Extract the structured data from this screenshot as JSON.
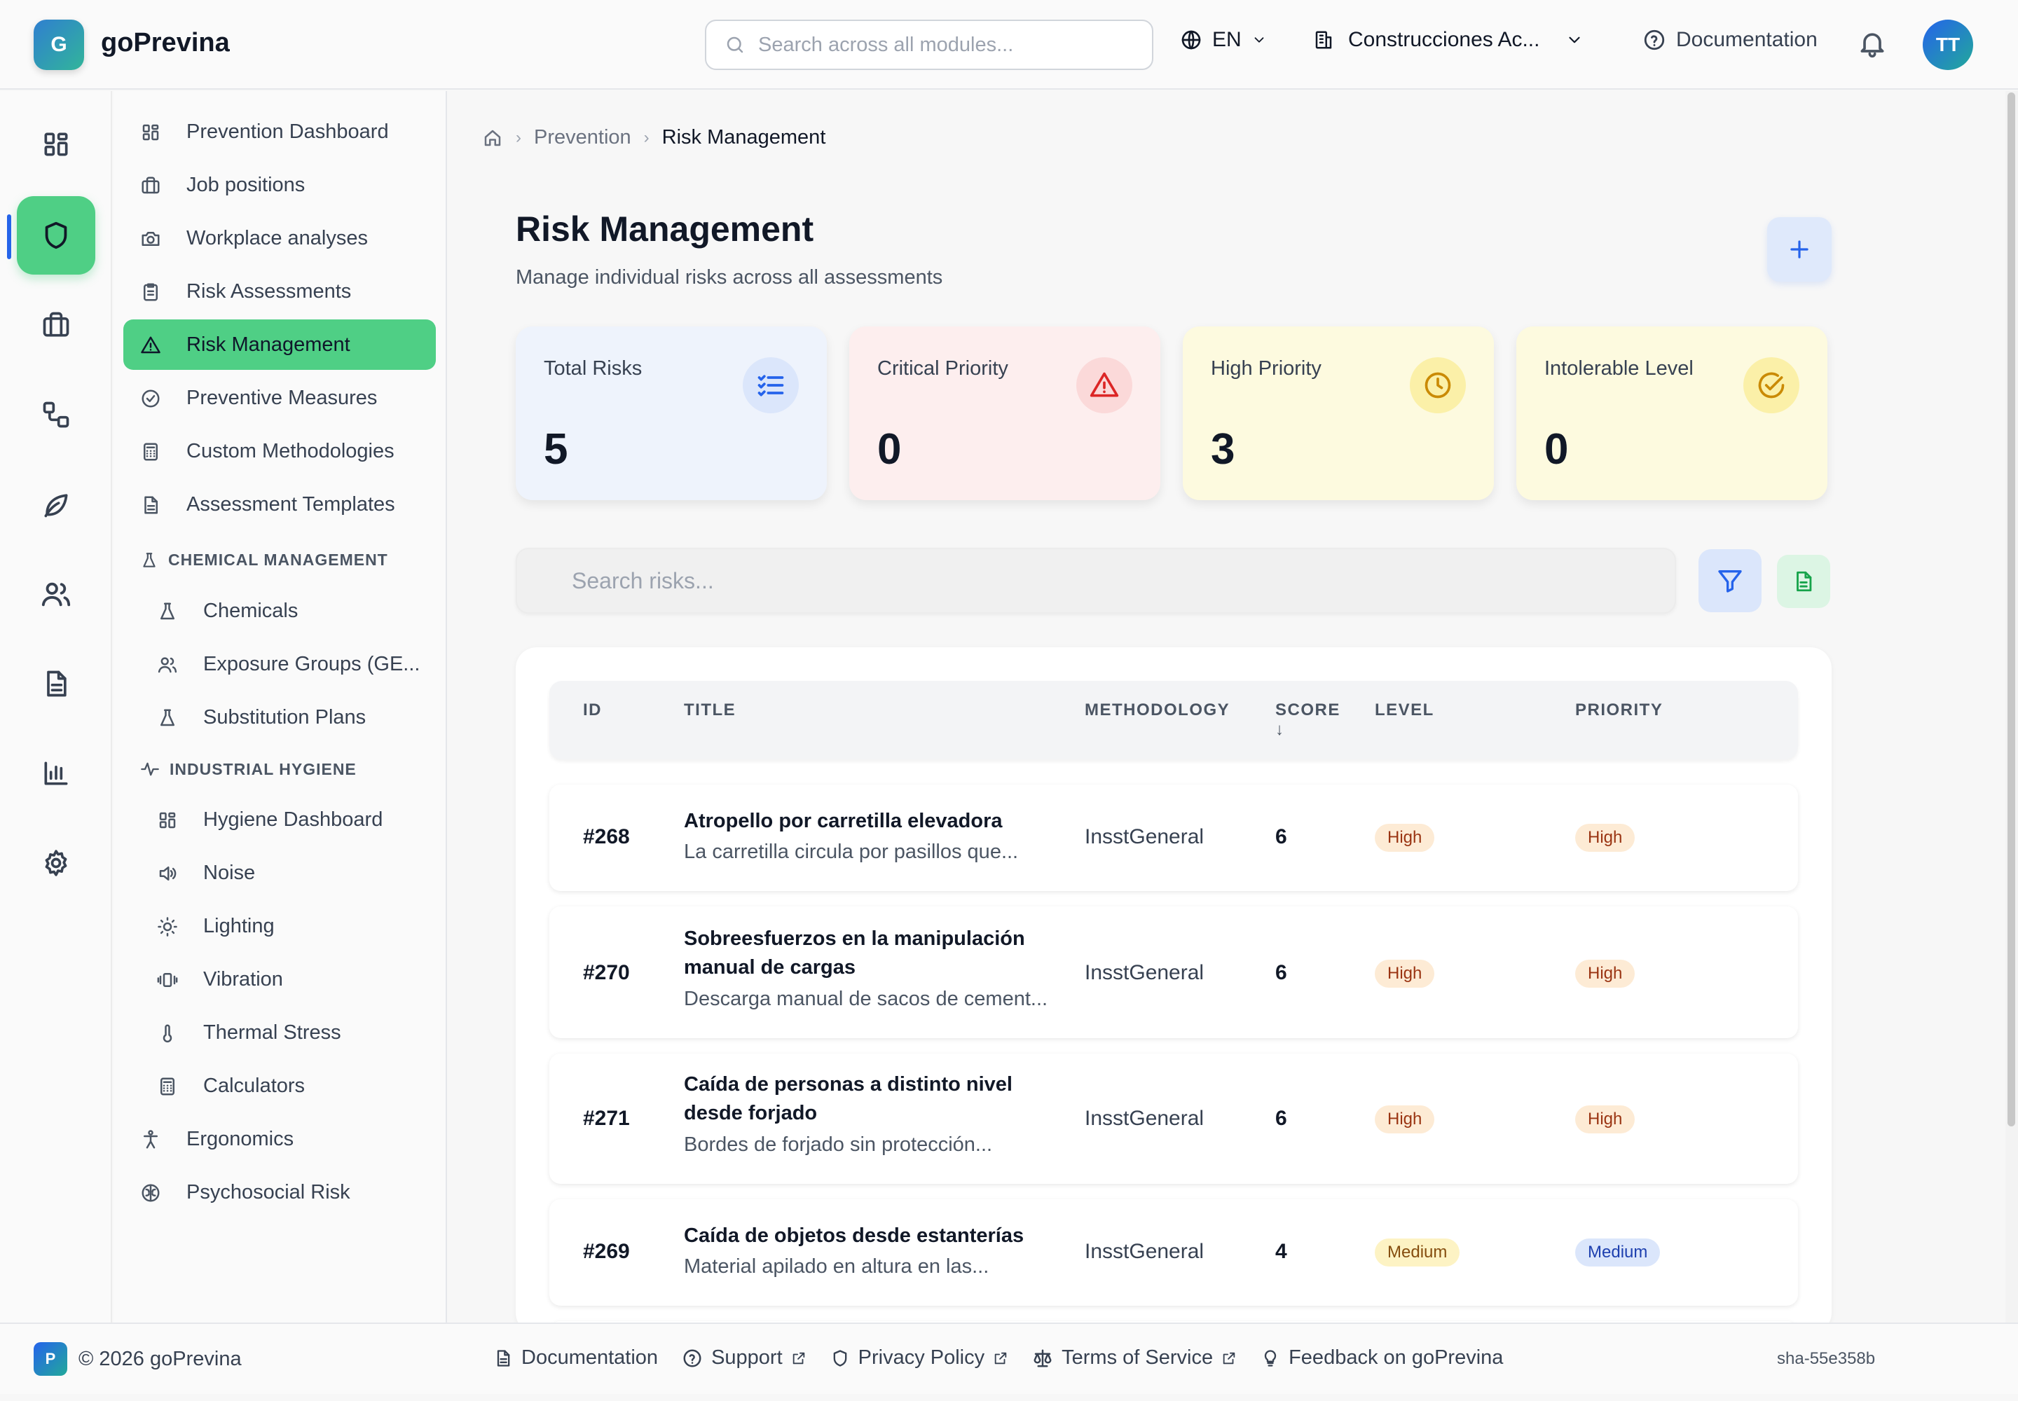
{
  "app": {
    "logo_letter": "G",
    "name": "goPrevina"
  },
  "header": {
    "search_placeholder": "Search across all modules...",
    "language": "EN",
    "organization": "Construcciones Ac...",
    "documentation": "Documentation",
    "user_initials": "TT"
  },
  "rail": {
    "active": "prevention",
    "items": [
      "dashboard",
      "prevention",
      "briefcase",
      "workflow",
      "environment",
      "people",
      "documents",
      "reports",
      "settings"
    ]
  },
  "sidebar": {
    "items": [
      {
        "label": "Prevention Dashboard",
        "icon": "dashboard-icon"
      },
      {
        "label": "Job positions",
        "icon": "briefcase-icon"
      },
      {
        "label": "Workplace analyses",
        "icon": "camera-icon"
      },
      {
        "label": "Risk Assessments",
        "icon": "clipboard-icon"
      },
      {
        "label": "Risk Management",
        "icon": "warning-icon",
        "active": true
      },
      {
        "label": "Preventive Measures",
        "icon": "check-circle-icon"
      },
      {
        "label": "Custom Methodologies",
        "icon": "calculator-icon"
      },
      {
        "label": "Assessment Templates",
        "icon": "document-icon"
      }
    ],
    "chemical_section": "CHEMICAL MANAGEMENT",
    "chemical_items": [
      {
        "label": "Chemicals",
        "icon": "flask-icon"
      },
      {
        "label": "Exposure Groups (GE...",
        "icon": "people-icon"
      },
      {
        "label": "Substitution Plans",
        "icon": "flask-icon"
      }
    ],
    "hygiene_section": "INDUSTRIAL HYGIENE",
    "hygiene_items": [
      {
        "label": "Hygiene Dashboard",
        "icon": "dashboard-icon"
      },
      {
        "label": "Noise",
        "icon": "speaker-icon"
      },
      {
        "label": "Lighting",
        "icon": "sun-icon"
      },
      {
        "label": "Vibration",
        "icon": "vibration-icon"
      },
      {
        "label": "Thermal Stress",
        "icon": "thermometer-icon"
      },
      {
        "label": "Calculators",
        "icon": "calculator-icon"
      }
    ],
    "bottom_items": [
      {
        "label": "Ergonomics",
        "icon": "person-icon"
      },
      {
        "label": "Psychosocial Risk",
        "icon": "brain-icon"
      }
    ]
  },
  "breadcrumb": {
    "section": "Prevention",
    "current": "Risk Management"
  },
  "page": {
    "title": "Risk Management",
    "subtitle": "Manage individual risks across all assessments"
  },
  "stats": [
    {
      "label": "Total Risks",
      "value": "5",
      "color": "#eef3fc",
      "accent": "#2563eb"
    },
    {
      "label": "Critical Priority",
      "value": "0",
      "color": "#fdeeee",
      "accent": "#dc2626"
    },
    {
      "label": "High Priority",
      "value": "3",
      "color": "#fdfadf",
      "accent": "#ca8a04"
    },
    {
      "label": "Intolerable Level",
      "value": "0",
      "color": "#fdfadf",
      "accent": "#ca8a04"
    }
  ],
  "risk_search_placeholder": "Search risks...",
  "table": {
    "columns": {
      "id": "ID",
      "title": "TITLE",
      "methodology": "METHODOLOGY",
      "score": "SCORE",
      "level": "LEVEL",
      "priority": "PRIORITY"
    },
    "sort_indicator": "↓",
    "rows": [
      {
        "id": "#268",
        "title": "Atropello por carretilla elevadora",
        "desc": "La carretilla circula por pasillos que...",
        "methodology": "InsstGeneral",
        "score": "6",
        "level": "High",
        "priority": "High"
      },
      {
        "id": "#270",
        "title": "Sobreesfuerzos en la manipulación manual de cargas",
        "desc": "Descarga manual de sacos de cement...",
        "methodology": "InsstGeneral",
        "score": "6",
        "level": "High",
        "priority": "High"
      },
      {
        "id": "#271",
        "title": "Caída de personas a distinto nivel desde forjado",
        "desc": "Bordes de forjado sin protección...",
        "methodology": "InsstGeneral",
        "score": "6",
        "level": "High",
        "priority": "High"
      },
      {
        "id": "#269",
        "title": "Caída de objetos desde estanterías",
        "desc": "Material apilado en altura en las...",
        "methodology": "InsstGeneral",
        "score": "4",
        "level": "Medium",
        "priority": "Medium"
      }
    ]
  },
  "footer": {
    "badge": "P",
    "copyright": "© 2026 goPrevina",
    "links": [
      "Documentation",
      "Support",
      "Privacy Policy",
      "Terms of Service",
      "Feedback on goPrevina"
    ],
    "version": "sha-55e358b"
  }
}
